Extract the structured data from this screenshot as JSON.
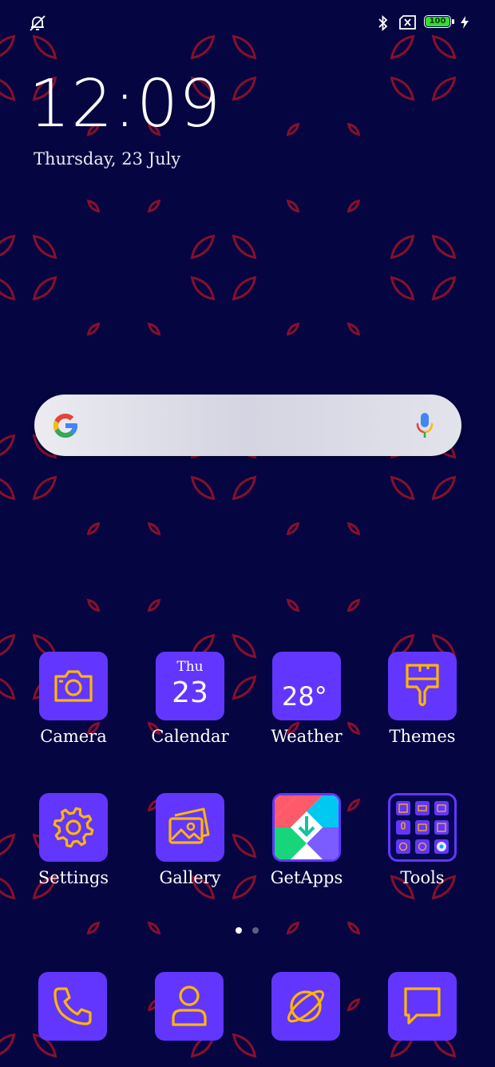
{
  "status_bar": {
    "left_icons": [
      "alarm-off-icon"
    ],
    "right_icons": [
      "bluetooth-icon",
      "no-sim-icon",
      "battery-icon",
      "charging-icon"
    ],
    "battery_level": "100"
  },
  "clock": {
    "time": "12:09",
    "date": "Thursday, 23 July"
  },
  "search": {
    "icons": [
      "google-logo-icon",
      "microphone-icon"
    ]
  },
  "apps": [
    {
      "label": "Camera",
      "icon": "camera-icon"
    },
    {
      "label": "Calendar",
      "icon": "calendar-icon",
      "day": "Thu",
      "date": "23"
    },
    {
      "label": "Weather",
      "icon": "weather-icon",
      "temp": "28°"
    },
    {
      "label": "Themes",
      "icon": "paintbrush-icon"
    },
    {
      "label": "Settings",
      "icon": "gear-icon"
    },
    {
      "label": "Gallery",
      "icon": "gallery-icon"
    },
    {
      "label": "GetApps",
      "icon": "getapps-icon"
    },
    {
      "label": "Tools",
      "icon": "tools-folder-icon"
    }
  ],
  "page_indicator": {
    "pages": 2,
    "current": 1
  },
  "dock": [
    {
      "icon": "phone-icon"
    },
    {
      "icon": "contacts-icon"
    },
    {
      "icon": "browser-icon"
    },
    {
      "icon": "messages-icon"
    }
  ],
  "colors": {
    "background": "#050541",
    "icon_bg": "#6236ff",
    "icon_fg": "#ffb700",
    "wallpaper_leaf": "#a01228",
    "battery": "#33dd33"
  }
}
